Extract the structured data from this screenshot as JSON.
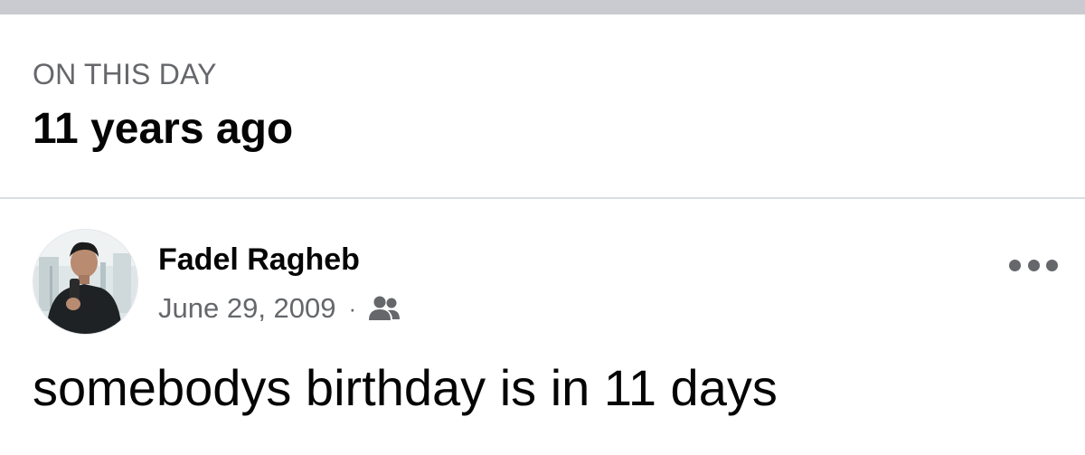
{
  "header": {
    "section_label": "ON THIS DAY",
    "title": "11 years ago"
  },
  "post": {
    "author_name": "Fadel Ragheb",
    "date": "June 29, 2009",
    "separator": "·",
    "audience_icon": "friends-icon",
    "more_icon": "more-options-icon",
    "text": "somebodys birthday is in 11 days"
  },
  "colors": {
    "top_bar": "#c9cbd0",
    "secondary_text": "#65676b",
    "primary_text": "#050505",
    "divider": "#dadde1"
  }
}
